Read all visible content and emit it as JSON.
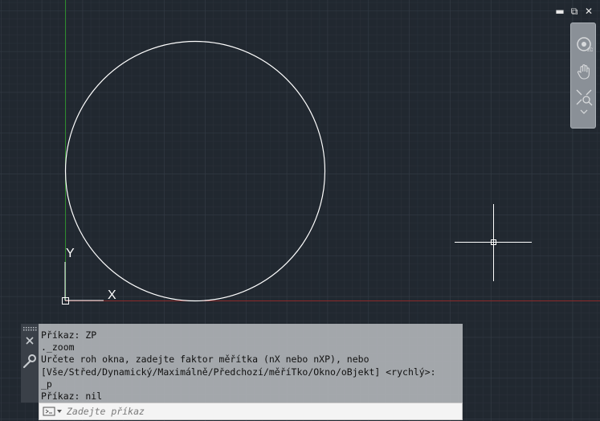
{
  "window_controls": {
    "minimize": "▬",
    "restore": "⧉",
    "close": "✕"
  },
  "navbar": {
    "tools": [
      "steering-wheel",
      "pan",
      "zoom-extents"
    ]
  },
  "ucs": {
    "x_label": "X",
    "y_label": "Y"
  },
  "command_line": {
    "history": [
      "Příkaz: ZP",
      "._zoom",
      "Určete roh okna, zadejte faktor měřítka (nX nebo nXP), nebo",
      "[Vše/Střed/Dynamický/Maximálně/Předchozí/měříTko/Okno/oBjekt] <rychlý>:",
      "_p",
      "Příkaz: nil"
    ],
    "placeholder": "Zadejte příkaz"
  },
  "colors": {
    "background": "#212830",
    "y_axis": "#2e8b2e",
    "x_axis": "#8b2a2a",
    "geometry": "#ffffff"
  }
}
